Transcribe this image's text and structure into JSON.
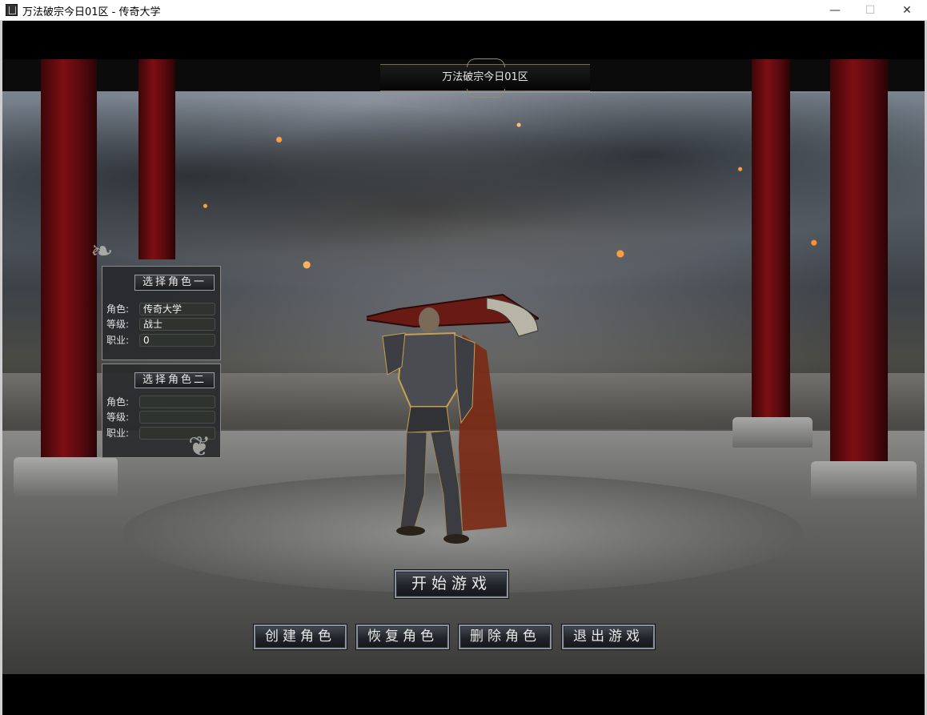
{
  "window": {
    "title": "万法破宗今日01区 - 传奇大学",
    "controls": {
      "minimize": "—",
      "maximize": "☐",
      "close": "✕"
    }
  },
  "server": {
    "name": "万法破宗今日01区"
  },
  "character_slots": [
    {
      "select_label": "选择角色一",
      "fields": [
        {
          "label": "角色:",
          "value": "传奇大学"
        },
        {
          "label": "等级:",
          "value": "战士"
        },
        {
          "label": "职业:",
          "value": "0"
        }
      ]
    },
    {
      "select_label": "选择角色二",
      "fields": [
        {
          "label": "角色:",
          "value": ""
        },
        {
          "label": "等级:",
          "value": ""
        },
        {
          "label": "职业:",
          "value": ""
        }
      ]
    }
  ],
  "buttons": {
    "start": "开始游戏",
    "create": "创建角色",
    "restore": "恢复角色",
    "delete": "删除角色",
    "exit": "退出游戏"
  },
  "icons": [
    "app-icon",
    "minimize-icon",
    "maximize-icon",
    "close-icon",
    "dragon-ornament-icon"
  ],
  "colors": {
    "pillar_red": "#7c0f14",
    "button_border": "#8a92a0",
    "panel_bg": "#282a2c",
    "ember": "#ffa040"
  }
}
